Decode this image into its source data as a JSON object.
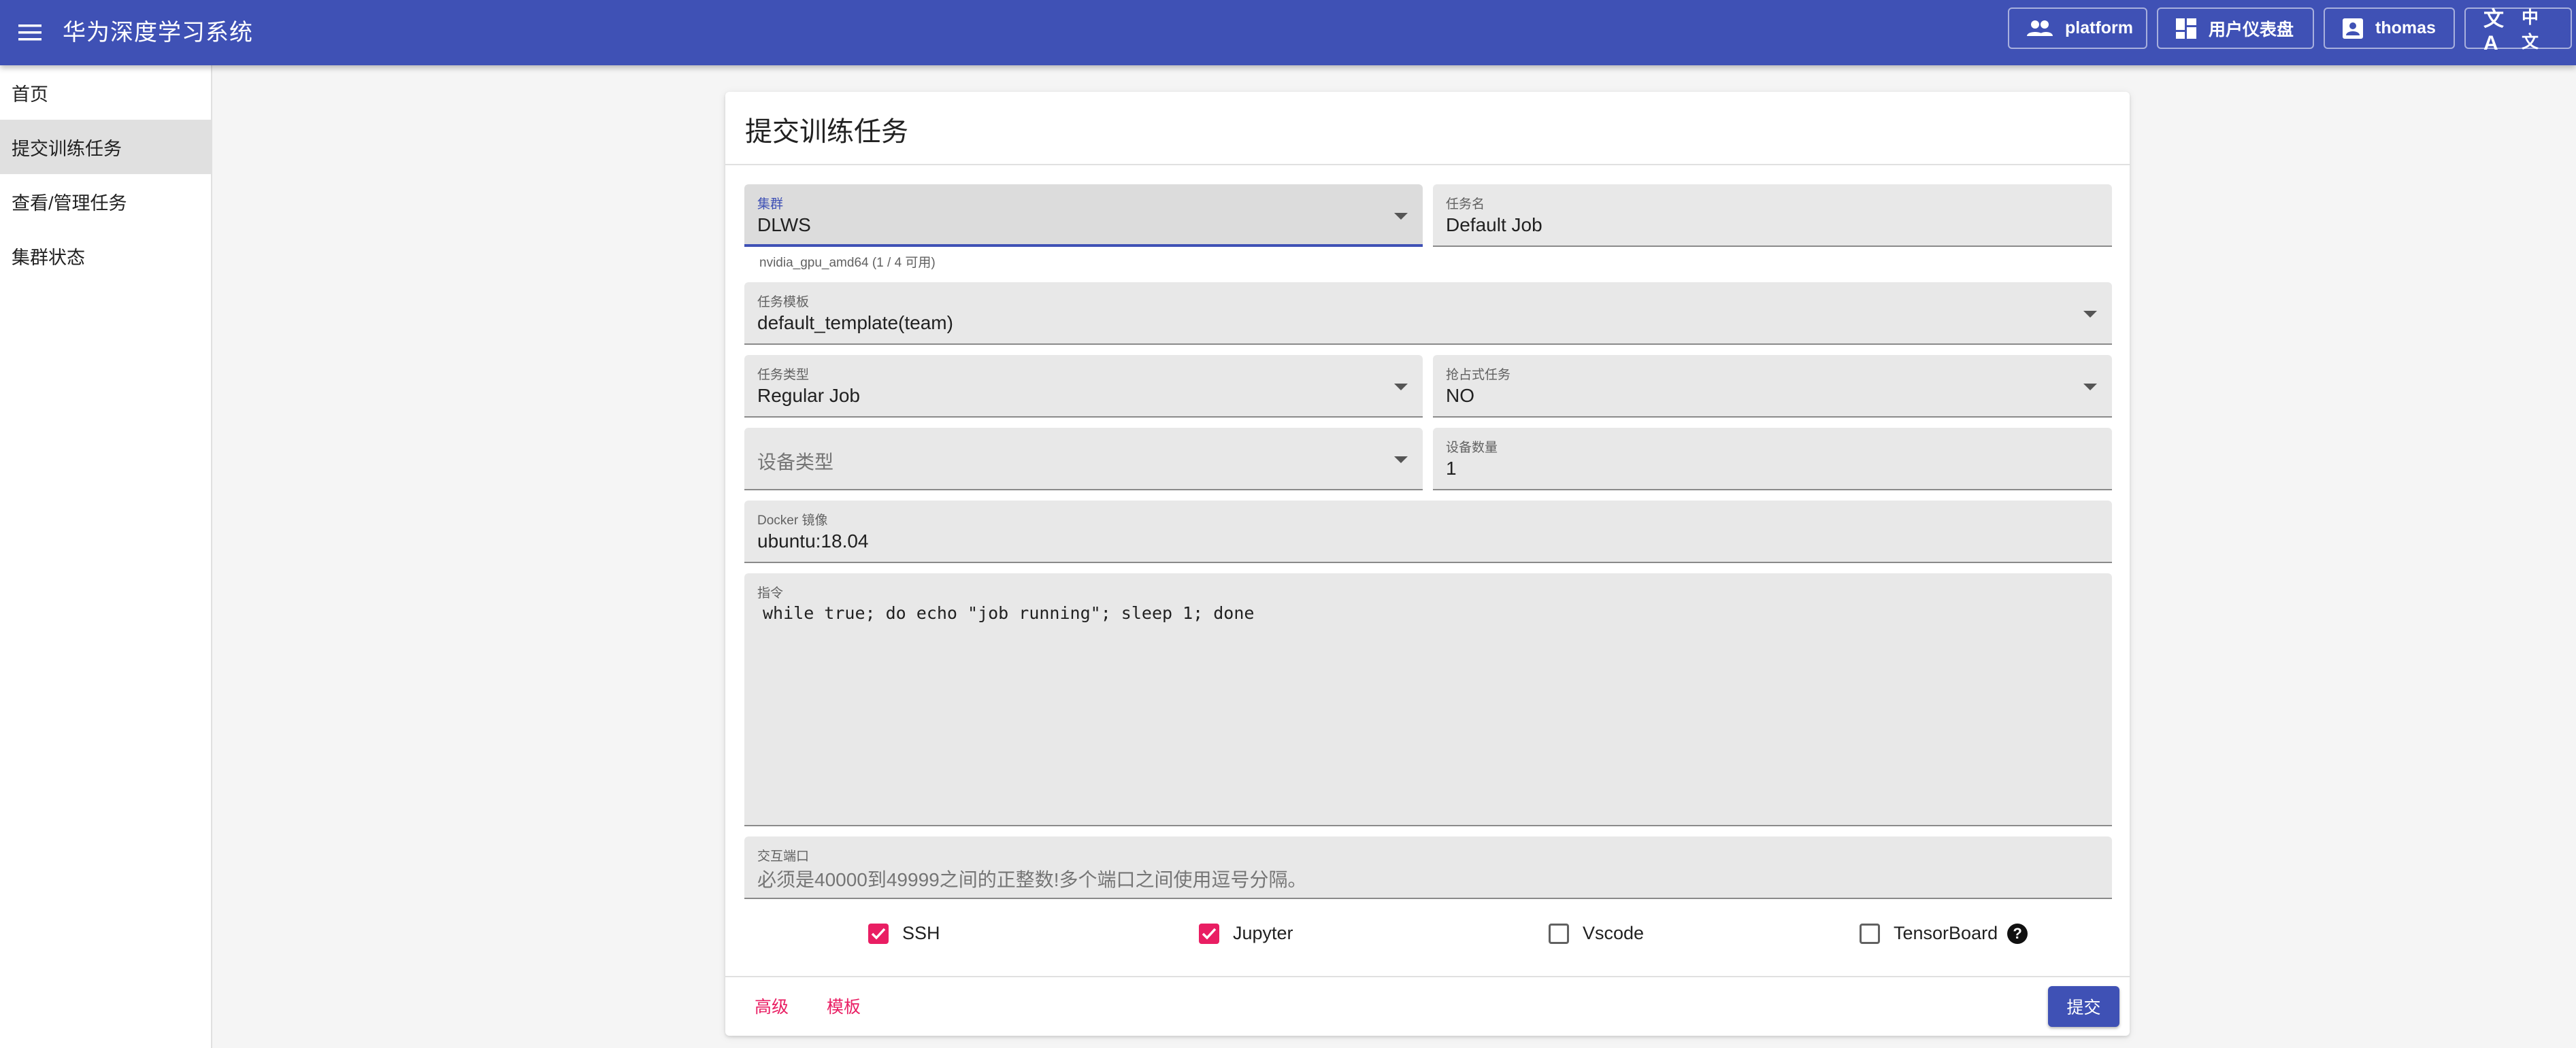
{
  "app": {
    "title": "华为深度学习系统",
    "top_buttons": [
      {
        "label": "platform",
        "icon": "people-icon"
      },
      {
        "label": "用户仪表盘",
        "icon": "dashboard-icon"
      },
      {
        "label": "thomas",
        "icon": "account-box-icon"
      },
      {
        "label": "中文",
        "icon": "translate-icon"
      }
    ]
  },
  "sidebar": {
    "items": [
      {
        "label": "首页",
        "active": false
      },
      {
        "label": "提交训练任务",
        "active": true
      },
      {
        "label": "查看/管理任务",
        "active": false
      },
      {
        "label": "集群状态",
        "active": false
      }
    ]
  },
  "form": {
    "title": "提交训练任务",
    "cluster": {
      "label": "集群",
      "value": "DLWS",
      "helper": "nvidia_gpu_amd64 (1 / 4 可用)"
    },
    "job_name": {
      "label": "任务名",
      "value": "Default Job"
    },
    "template": {
      "label": "任务模板",
      "value": "default_template(team)"
    },
    "job_type": {
      "label": "任务类型",
      "value": "Regular Job"
    },
    "preemptible": {
      "label": "抢占式任务",
      "value": "NO"
    },
    "device_type": {
      "placeholder": "设备类型"
    },
    "device_count": {
      "label": "设备数量",
      "value": "1"
    },
    "docker_image": {
      "label": "Docker 镜像",
      "value": "ubuntu:18.04"
    },
    "command": {
      "label": "指令",
      "value": "while true; do echo \"job running\"; sleep 1; done"
    },
    "ports": {
      "label": "交互端口",
      "placeholder": "必须是40000到49999之间的正整数!多个端口之间使用逗号分隔。"
    },
    "checkboxes": [
      {
        "label": "SSH",
        "checked": true
      },
      {
        "label": "Jupyter",
        "checked": true
      },
      {
        "label": "Vscode",
        "checked": false
      },
      {
        "label": "TensorBoard",
        "checked": false,
        "help": "?"
      }
    ],
    "actions": {
      "advanced": "高级",
      "template": "模板",
      "submit": "提交"
    }
  },
  "colors": {
    "primary": "#3f51b5",
    "accent": "#e91e63"
  }
}
